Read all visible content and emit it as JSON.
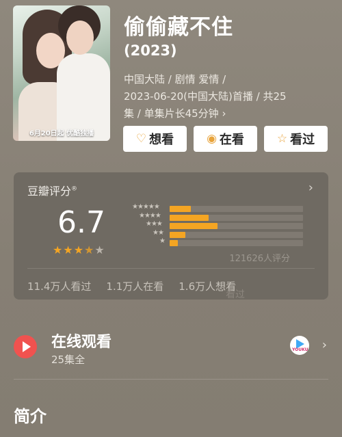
{
  "movie": {
    "title": "偷偷藏不住",
    "year": "(2023)",
    "meta_line1": "中国大陆 / 剧情 爱情 /",
    "meta_line2": "2023-06-20(中国大陆)首播 / 共25",
    "meta_line3": "集 / 单集片长45分钟 ›",
    "poster_caption": "6月20日起 优酷独播"
  },
  "actions": {
    "want_label": "想看",
    "watching_label": "在看",
    "watched_label": "看过"
  },
  "rating": {
    "title": "豆瓣评分",
    "score": "6.7",
    "stars_filled": 3.5,
    "distribution": [
      {
        "stars": 5,
        "fraction": 0.16
      },
      {
        "stars": 4,
        "fraction": 0.29
      },
      {
        "stars": 3,
        "fraction": 0.36
      },
      {
        "stars": 2,
        "fraction": 0.12
      },
      {
        "stars": 1,
        "fraction": 0.06
      }
    ],
    "votes": "121626人评分",
    "watched": "11.4万人看过",
    "watching": "1.1万人在看",
    "want": "1.6万人想看",
    "watermark": "看过"
  },
  "online": {
    "title": "在线观看",
    "subtitle": "25集全",
    "platform_label": "YOUKU"
  },
  "intro": {
    "heading": "简介"
  },
  "colors": {
    "accent_star": "#f4a523",
    "play_red": "#f0524f",
    "background": "#8a8378"
  }
}
